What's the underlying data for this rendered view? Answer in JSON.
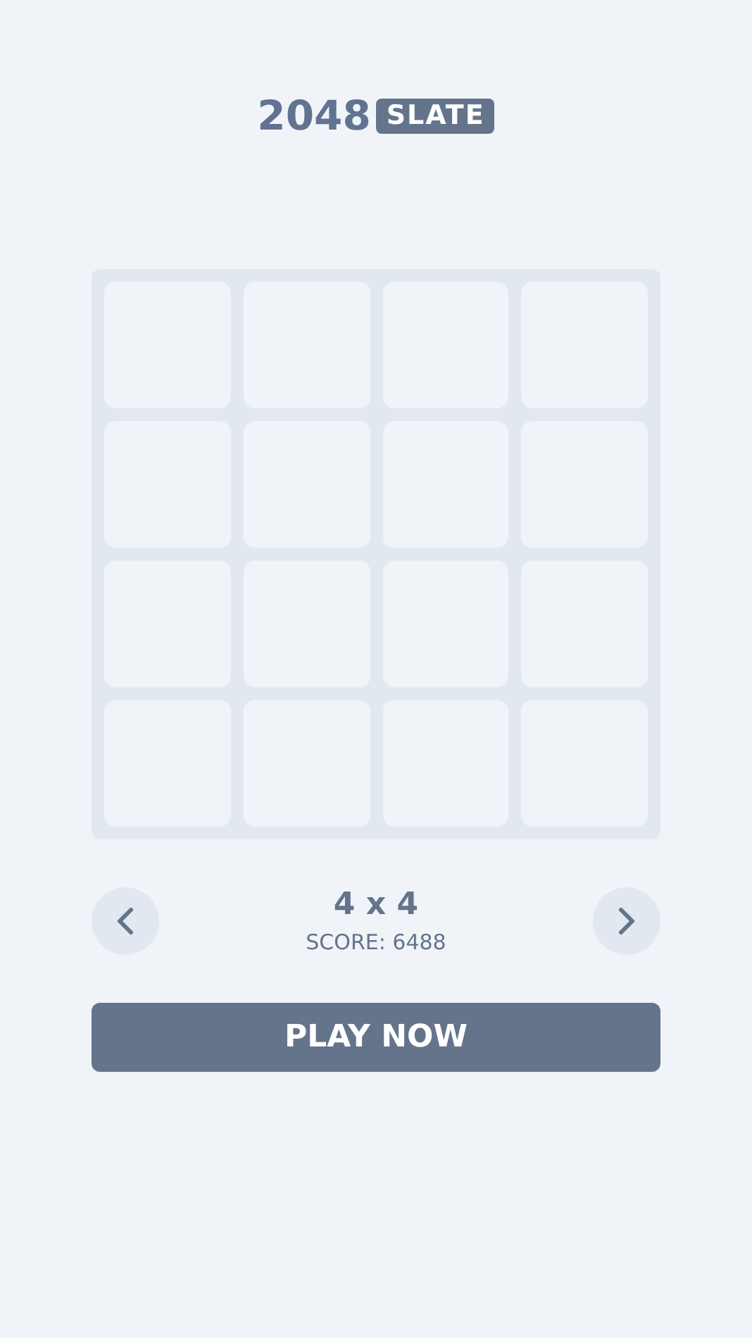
{
  "header": {
    "title": "2048",
    "badge": "SLATE"
  },
  "board": {
    "rows": [
      [
        {
          "kind": "empty"
        },
        {
          "kind": "empty"
        },
        {
          "kind": "empty"
        },
        {
          "kind": "empty"
        }
      ],
      [
        {
          "kind": "empty"
        },
        {
          "kind": "empty"
        },
        {
          "kind": "empty"
        },
        {
          "kind": "empty"
        }
      ],
      [
        {
          "kind": "empty"
        },
        {
          "kind": "empty"
        },
        {
          "kind": "empty"
        },
        {
          "kind": "empty"
        }
      ],
      [
        {
          "kind": "empty"
        },
        {
          "kind": "empty"
        },
        {
          "kind": "empty"
        },
        {
          "kind": "empty"
        }
      ]
    ]
  },
  "size_selector": {
    "size": "4 x 4",
    "score": "SCORE: 6488"
  },
  "play_button": {
    "label": "PLAY NOW"
  }
}
